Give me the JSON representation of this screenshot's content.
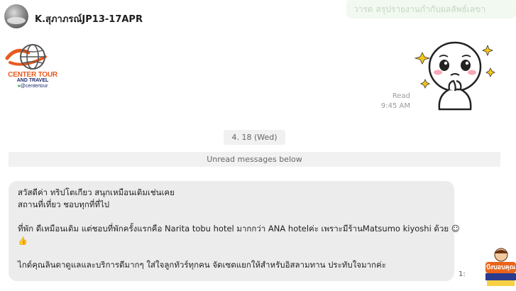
{
  "header": {
    "chat_title": "K.สุภาภรณ์JP13-17APR",
    "faded_preview": "วารด สรุปรายงานกำกับผลลัพธ์เลขา"
  },
  "logo": {
    "line1": "CENTER TOUR",
    "line2": "AND TRAVEL",
    "line3": "@centertour"
  },
  "read_receipt": {
    "status": "Read",
    "time": "9:45 AM"
  },
  "date_separator": "4. 18 (Wed)",
  "unread_label": "Unread messages below",
  "message": {
    "line1": "สวัสดีค่า ทริปโตเกียว สนุกเหมือนเดิมเช่นเคย",
    "line2": "สถานที่เที่ยว ชอบทุกที่ที่ไป",
    "line3": "ที่พัก ดีเหมือนเดิม แต่ชอบที่พักครั้งแรกคือ Narita tobu hotel มากกว่า ANA hotelค่ะ เพราะมีร้านMatsumo kiyoshi ด้วย ☺",
    "line4": "👍",
    "line5": "ไกด์คุณลินดาดูแลและบริการดีมากๆ ใส่ใจลูกทัวร์ทุกคน จัดเซตแยกให้สำหรับอิสลามทาน ประทับใจมากค่ะ"
  },
  "message_time_peek": "1:",
  "badge": {
    "text": "ปังบอบคุณ"
  },
  "colors": {
    "bubble_bg": "#ececec",
    "chip_bg": "#f1f1f1",
    "logo_orange": "#e85a1f",
    "logo_navy": "#1b2a6b",
    "sparkle": "#f5c518"
  }
}
